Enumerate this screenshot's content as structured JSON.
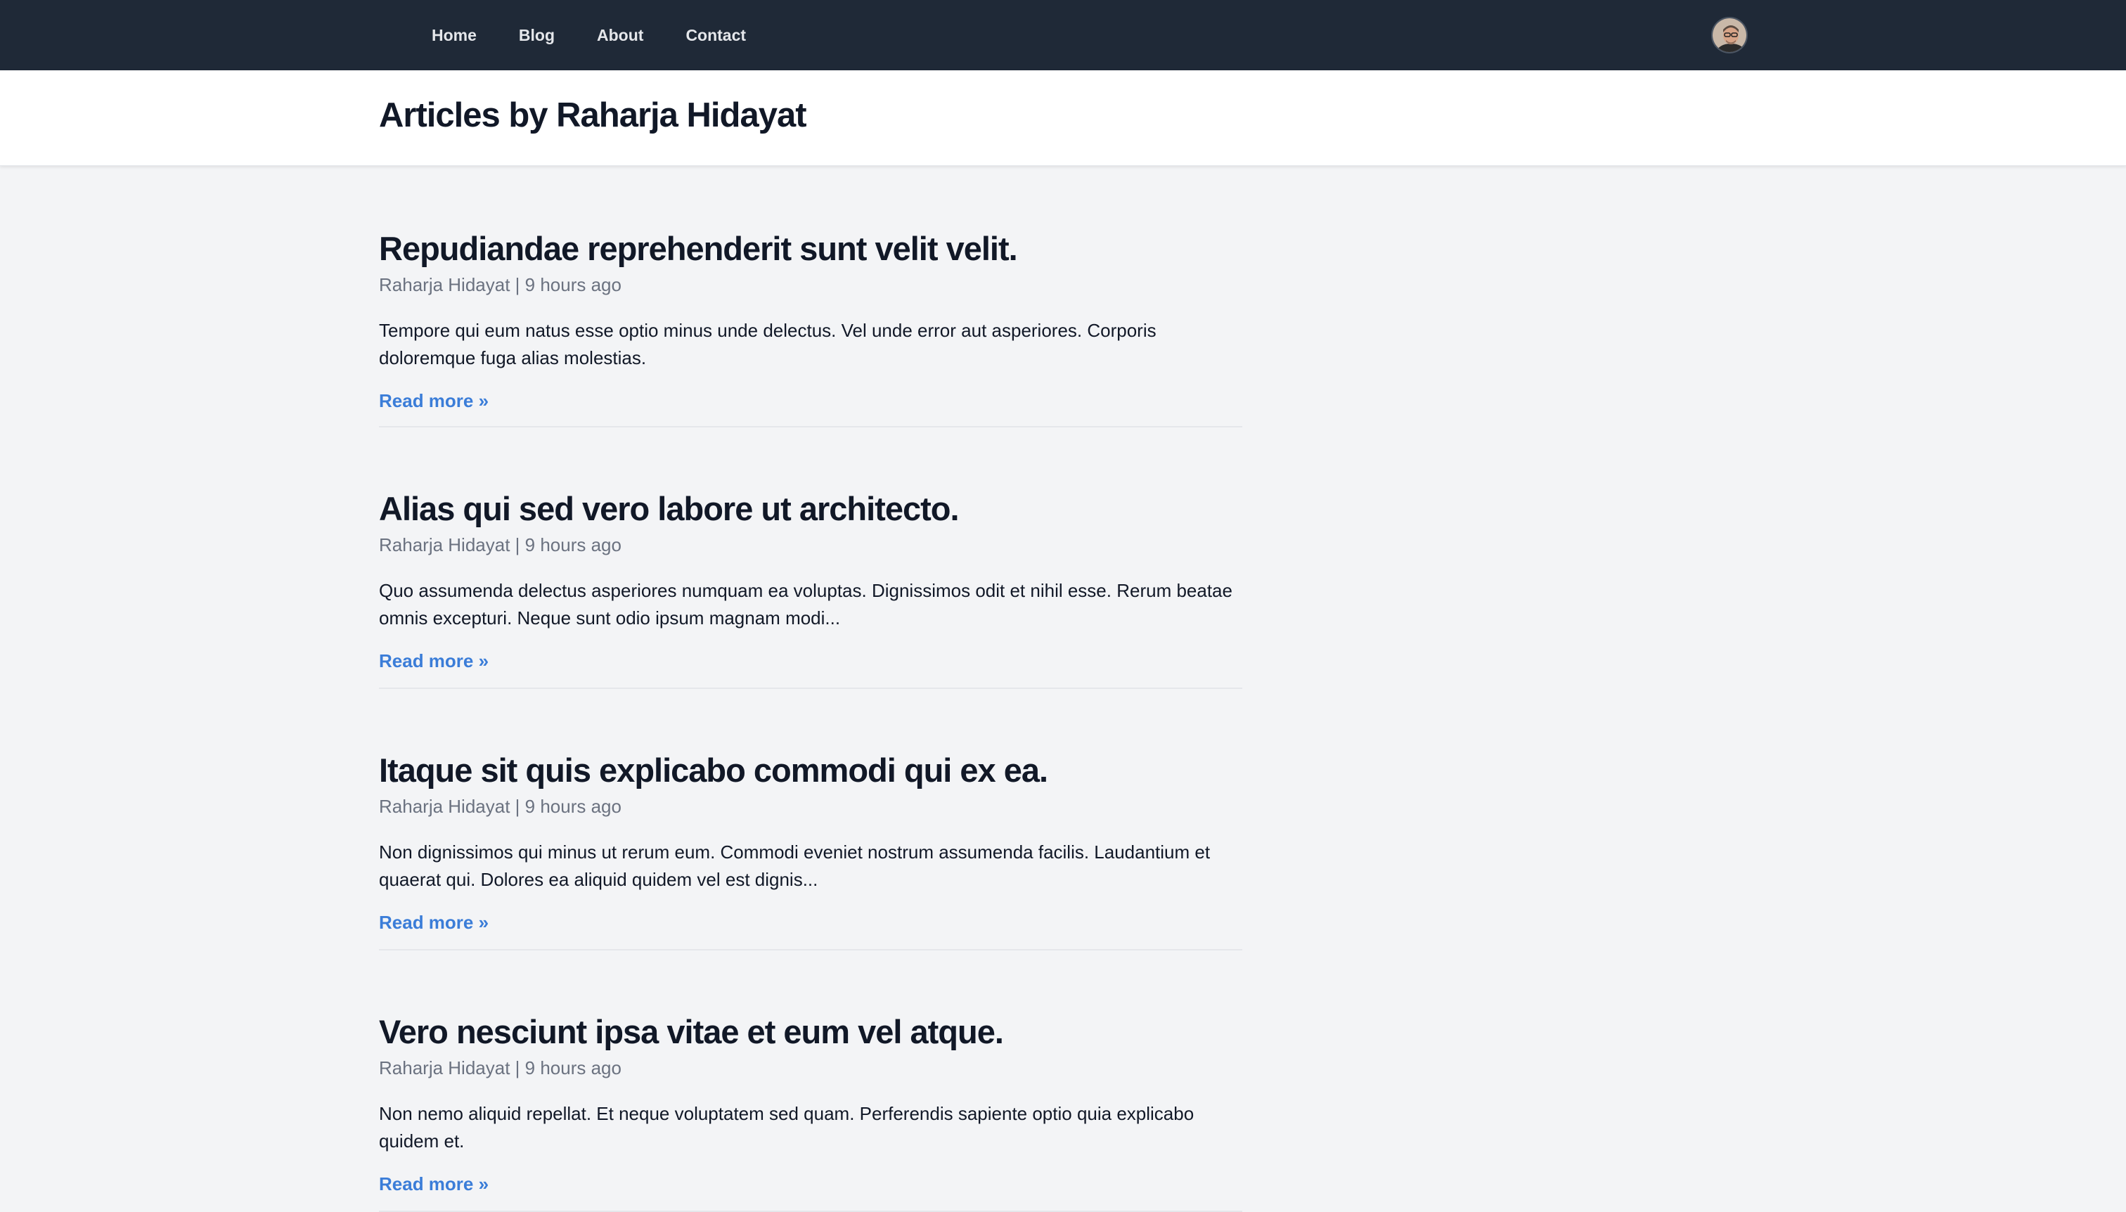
{
  "nav": {
    "links": [
      "Home",
      "Blog",
      "About",
      "Contact"
    ]
  },
  "header": {
    "title": "Articles by Raharja Hidayat"
  },
  "articles": [
    {
      "title": "Repudiandae reprehenderit sunt velit velit.",
      "meta": "Raharja Hidayat | 9 hours ago",
      "excerpt": "Tempore qui eum natus esse optio minus unde delectus. Vel unde error aut asperiores. Corporis doloremque fuga alias molestias.",
      "read_more": "Read more »"
    },
    {
      "title": "Alias qui sed vero labore ut architecto.",
      "meta": "Raharja Hidayat | 9 hours ago",
      "excerpt": "Quo assumenda delectus asperiores numquam ea voluptas. Dignissimos odit et nihil esse. Rerum beatae omnis excepturi. Neque sunt odio ipsum magnam modi...",
      "read_more": "Read more »"
    },
    {
      "title": "Itaque sit quis explicabo commodi qui ex ea.",
      "meta": "Raharja Hidayat | 9 hours ago",
      "excerpt": "Non dignissimos qui minus ut rerum eum. Commodi eveniet nostrum assumenda facilis. Laudantium et quaerat qui. Dolores ea aliquid quidem vel est dignis...",
      "read_more": "Read more »"
    },
    {
      "title": "Vero nesciunt ipsa vitae et eum vel atque.",
      "meta": "Raharja Hidayat | 9 hours ago",
      "excerpt": "Non nemo aliquid repellat. Et neque voluptatem sed quam. Perferendis sapiente optio quia explicabo quidem et.",
      "read_more": "Read more »"
    }
  ],
  "colors": {
    "nav_bg": "#1f2937",
    "page_bg": "#f3f4f6",
    "link": "#3b7dd8",
    "title": "#111827",
    "meta": "#6b7280"
  }
}
